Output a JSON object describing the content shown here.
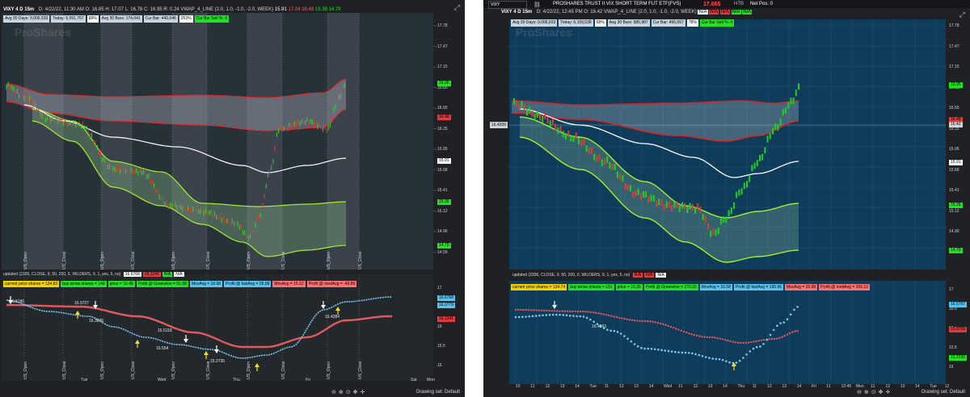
{
  "left": {
    "title": {
      "symbol": "VIXY 4 D 15m",
      "date": "D: 4/22/22, 11:30 AM",
      "o": "O: 16.85",
      "h": "H: 17.07",
      "l": "L: 16.78",
      "c": "C: 16.95",
      "r": "R: 0.24",
      "vwap": "VWAP_4_LINE (2.0, 1.0, -1.0, -2.0, WEEK)",
      "v1": "15.91",
      "v2": "17.04",
      "v3": "16.48",
      "v4": "15.35",
      "v5": "14.79"
    },
    "chips": [
      {
        "text": "Avg 30 Days: 9,006,933",
        "bg": "#c8d4e0"
      },
      {
        "text": "Today: 6,091,767",
        "bg": "#c8d4e0"
      },
      {
        "text": "68%",
        "bg": "#ffffff"
      },
      {
        "text": "Avg 30 Bars: 174,041",
        "bg": "#c8d4e0"
      },
      {
        "text": "Cur Bar: 440,646",
        "bg": "#c8d4e0"
      },
      {
        "text": "253%",
        "bg": "#ffffff"
      },
      {
        "text": "Cur Bar Sell %: 4",
        "bg": "#22e022"
      }
    ],
    "price_labels": [
      {
        "t": "17.78"
      },
      {
        "t": "17.47"
      },
      {
        "t": "17.15"
      },
      {
        "t": "16.85"
      },
      {
        "t": "16.55"
      },
      {
        "t": "16.25"
      },
      {
        "t": "15.95"
      },
      {
        "t": "15.68"
      },
      {
        "t": "15.41"
      },
      {
        "t": "15.12"
      },
      {
        "t": "14.90"
      },
      {
        "t": "14.59"
      }
    ],
    "right_tags": [
      {
        "t": "16.95",
        "bg": "#22e022"
      },
      {
        "t": "16.48",
        "bg": "#e03a3a"
      },
      {
        "t": "15.91",
        "bg": "#ffffff"
      },
      {
        "t": "15.35",
        "bg": "#22e022"
      },
      {
        "t": "14.79",
        "bg": "#22e022"
      }
    ],
    "session_labels": [
      "US_Open",
      "US_Close",
      "US_Open",
      "US_Close",
      "US_Open",
      "US_Close",
      "US_Open",
      "US_Close",
      "US_Open",
      "US_Close"
    ],
    "status": "updated (2300, CLOSE, 9, 50, 200, 0, WILDERS, 9, 1, yes, 5, no)",
    "status_vals": [
      {
        "t": "16.6768",
        "bg": "#ffffff"
      },
      {
        "t": "16.1241",
        "bg": "#e03a3a"
      },
      {
        "t": "N/A",
        "bg": "#22e022"
      },
      {
        "t": "N/A",
        "bg": "#ffffff"
      }
    ],
    "lower_labels": [
      {
        "text": "current price shares = 134.83",
        "bg": "#f5d000"
      },
      {
        "text": "buy arrow shares = 140",
        "bg": "#22e022"
      },
      {
        "text": "price = 16.48",
        "bg": "#22e022"
      },
      {
        "text": "Profit @ GreenArw = 81.58",
        "bg": "#22e022"
      },
      {
        "text": "MovAvg = 16.68",
        "bg": "#59c3f0"
      },
      {
        "text": "Profit @ fastAvg = 28.09",
        "bg": "#59c3f0"
      },
      {
        "text": "MovAvg = 16.12",
        "bg": "#ff7070"
      },
      {
        "text": "Profit @ medAvg = -49.86",
        "bg": "#ff7070"
      }
    ],
    "lower_price_labels": [
      "17",
      "16.5",
      "16",
      "15.5",
      "15"
    ],
    "lower_tags": [
      {
        "t": "16.6768",
        "bg": "#59c3f0"
      },
      {
        "t": "16.3779",
        "bg": "#59c3f0"
      },
      {
        "t": "16.1241",
        "bg": "#e03a3a"
      }
    ],
    "annotations": [
      "16.8186",
      "16.9727",
      "16.3876",
      "15.5118",
      "15.554",
      "15.2735",
      "16.4284"
    ],
    "x_labels": [
      "Tue",
      "Wed",
      "Thu",
      "Fri",
      "Sat",
      "Mon"
    ],
    "drawing_set": "Drawing set: Default",
    "watermark": "ProShares"
  },
  "right": {
    "topbar": {
      "symbol": "VIXY",
      "name": "PROSHARES TRUST II VIX SHORT TERM FUT ETF(FVS)",
      "price": "17.065",
      "htb": "HTB",
      "netpos": "Net Pos: 0"
    },
    "title": {
      "symbol": "VIXY 4 D 15m",
      "date": "D: 4/22/22, 12:45 PM",
      "o": "O: 16.42",
      "vwap": "VWAP_4_LINE (2.0, 1.0, -1.0, -2.0, WEEK)",
      "n1": "N/A",
      "n2": "N/A",
      "n3": "N/A",
      "n4": "N/A",
      "n5": "N/A"
    },
    "chips": [
      {
        "text": "Avg 30 Days: 9,006,933",
        "bg": "#c8d4e0"
      },
      {
        "text": "Today: 6,109,538",
        "bg": "#c8d4e0"
      },
      {
        "text": "68%",
        "bg": "#ffffff"
      },
      {
        "text": "Avg 30 Bars: 586,987",
        "bg": "#c8d4e0"
      },
      {
        "text": "Cur Bar: 456,057",
        "bg": "#c8d4e0"
      },
      {
        "text": "78%",
        "bg": "#ffffff"
      },
      {
        "text": "Cur Bar Sell %: 4",
        "bg": "#22e022"
      }
    ],
    "price_labels": [
      {
        "t": "17.78"
      },
      {
        "t": "17.47"
      },
      {
        "t": "17.15"
      },
      {
        "t": "16.85"
      },
      {
        "t": "16.55"
      },
      {
        "t": "16.25"
      },
      {
        "t": "15.95"
      },
      {
        "t": "15.68"
      },
      {
        "t": "15.41"
      },
      {
        "t": "15.12"
      },
      {
        "t": "14.90"
      },
      {
        "t": "14.59"
      }
    ],
    "right_tags": [
      {
        "t": "16.95",
        "bg": "#22e022"
      },
      {
        "t": "16.48",
        "bg": "#e03a3a"
      },
      {
        "t": "16.42",
        "bg": "#cfd3d6"
      },
      {
        "t": "15.91",
        "bg": "#ffffff"
      },
      {
        "t": "15.35",
        "bg": "#22e022"
      },
      {
        "t": "14.79",
        "bg": "#22e022"
      }
    ],
    "cursor_price": "16.4209",
    "status": "updated (2300, CLOSE, 9, 50, 200, 0, WILDERS, 9, 1, yes, 5, no)",
    "status_vals": [
      {
        "t": "N/A",
        "bg": "#e03a3a"
      },
      {
        "t": "N/A",
        "bg": "#e03a3a"
      },
      {
        "t": "N/A",
        "bg": "#ffffff"
      }
    ],
    "lower_labels": [
      {
        "text": "current price shares = 134.74",
        "bg": "#f5d000"
      },
      {
        "text": "buy arrow shares = 151",
        "bg": "#22e022"
      },
      {
        "text": "price = 16.26",
        "bg": "#22e022"
      },
      {
        "text": "Profit @ GreenArw = 270.25",
        "bg": "#22e022"
      },
      {
        "text": "MovAvg = 16.58",
        "bg": "#59c3f0"
      },
      {
        "text": "Profit @ fastAvg = 195.96",
        "bg": "#59c3f0"
      },
      {
        "text": "MovAvg = 15.98",
        "bg": "#ff7070"
      },
      {
        "text": "Profit @ medAvg = 106.12",
        "bg": "#ff7070"
      }
    ],
    "lower_price_labels": [
      "17",
      "16.5",
      "16",
      "15.5",
      "15"
    ],
    "lower_tags": [
      {
        "t": "16.5767",
        "bg": "#59c3f0"
      },
      {
        "t": "15.9799",
        "bg": "#e03a3a"
      },
      {
        "t": "15.2132",
        "bg": "#22e022"
      }
    ],
    "annotations": [
      "16.4503"
    ],
    "x_labels": [
      "10",
      "11",
      "12",
      "13",
      "14",
      "Tue",
      "11",
      "12",
      "13",
      "14",
      "Wed",
      "11",
      "12",
      "13",
      "14",
      "Thu",
      "11",
      "12",
      "13",
      "14",
      "Fri",
      "11",
      "12:45",
      "Mon",
      "11",
      "12",
      "13",
      "14",
      "Tue",
      "12"
    ],
    "drawing_set": "Drawing set: Default",
    "watermark": "ProShares"
  }
}
